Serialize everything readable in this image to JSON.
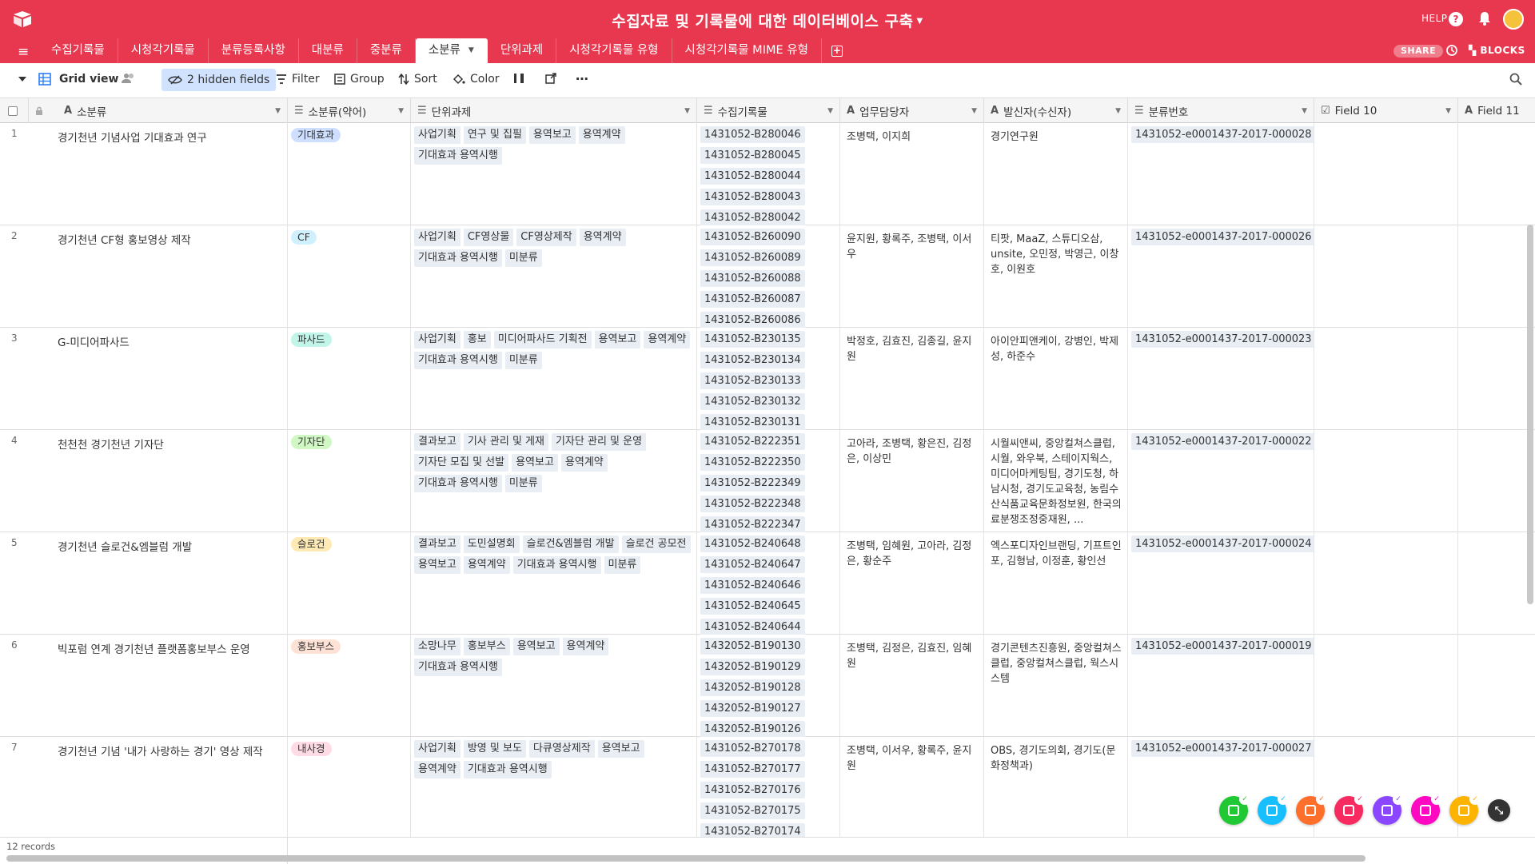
{
  "app": {
    "base_title": "수집자료 및 기록물에 대한 데이터베이스 구축",
    "help_label": "HELP",
    "share_label": "SHARE",
    "blocks_label": "BLOCKS",
    "brand_color": "#e8384f"
  },
  "tabs": [
    {
      "label": "수집기록물"
    },
    {
      "label": "시청각기록물"
    },
    {
      "label": "분류등록사항"
    },
    {
      "label": "대분류"
    },
    {
      "label": "중분류"
    },
    {
      "label": "소분류",
      "active": true
    },
    {
      "label": "단위과제"
    },
    {
      "label": "시청각기록물 유형"
    },
    {
      "label": "시청각기록물 MIME 유형"
    }
  ],
  "toolbar": {
    "view_name": "Grid view",
    "hidden_fields": "2 hidden fields",
    "filter": "Filter",
    "group": "Group",
    "sort": "Sort",
    "color": "Color"
  },
  "columns": [
    {
      "name": "소분류",
      "icon": "A"
    },
    {
      "name": "소분류(약어)",
      "icon": "☰"
    },
    {
      "name": "단위과제",
      "icon": "☰"
    },
    {
      "name": "수집기록물",
      "icon": "☰"
    },
    {
      "name": "업무담당자",
      "icon": "A"
    },
    {
      "name": "발신자(수신자)",
      "icon": "A"
    },
    {
      "name": "분류번호",
      "icon": "☰"
    },
    {
      "name": "Field 10",
      "icon": "☑"
    },
    {
      "name": "Field 11",
      "icon": "A"
    }
  ],
  "rows": [
    {
      "num": "1",
      "name": "경기천년 기념사업 기대효과 연구",
      "abbr": "기대효과",
      "abbr_color": "#cfdfff",
      "tasks": [
        "사업기획",
        "연구 및 집필",
        "용역보고",
        "용역계약",
        "기대효과 용역시행"
      ],
      "records": [
        "1431052-B280046",
        "1431052-B280045",
        "1431052-B280044",
        "1431052-B280043",
        "1431052-B280042"
      ],
      "manager": "조병택, 이지희",
      "sender": "경기연구원",
      "classno": "1431052-e0001437-2017-000028"
    },
    {
      "num": "2",
      "name": "경기천년 CF형 홍보영상 제작",
      "abbr": "CF",
      "abbr_color": "#d0f0fd",
      "tasks": [
        "사업기획",
        "CF영상물",
        "CF영상제작",
        "용역계약",
        "기대효과 용역시행",
        "미분류"
      ],
      "records": [
        "1431052-B260090",
        "1431052-B260089",
        "1431052-B260088",
        "1431052-B260087",
        "1431052-B260086"
      ],
      "manager": "윤지원, 황록주, 조병택, 이서우",
      "sender": "티팟, MaaZ, 스튜디오삼, unsite, 오민정, 박영근, 이창호, 이원호",
      "classno": "1431052-e0001437-2017-000026"
    },
    {
      "num": "3",
      "name": "G-미디어파사드",
      "abbr": "파사드",
      "abbr_color": "#c2f5e9",
      "tasks": [
        "사업기획",
        "홍보",
        "미디어파사드 기획전",
        "용역보고",
        "용역계약",
        "기대효과 용역시행",
        "미분류"
      ],
      "records": [
        "1431052-B230135",
        "1431052-B230134",
        "1431052-B230133",
        "1431052-B230132",
        "1431052-B230131"
      ],
      "manager": "박정호, 김효진, 김종길, 윤지원",
      "sender": "아이안피앤케이, 강병인, 박제성, 하준수",
      "classno": "1431052-e0001437-2017-000023"
    },
    {
      "num": "4",
      "name": "천천천 경기천년 기자단",
      "abbr": "기자단",
      "abbr_color": "#d1f7c4",
      "tasks": [
        "결과보고",
        "기사 관리 및 게재",
        "기자단 관리 및 운영",
        "기자단 모집 및 선발",
        "용역보고",
        "용역계약",
        "기대효과 용역시행",
        "미분류"
      ],
      "records": [
        "1431052-B222351",
        "1431052-B222350",
        "1431052-B222349",
        "1431052-B222348",
        "1431052-B222347"
      ],
      "manager": "고아라, 조병택, 황은진, 김정은, 이상민",
      "sender": "시월씨앤씨, 중앙컬쳐스클럽, 시월, 와우북, 스테이지웍스, 미디어마케팅팀, 경기도청, 하남시청, 경기도교육청, 농림수산식품교육문화정보원, 한국의료분쟁조정중재원, ...",
      "classno": "1431052-e0001437-2017-000022"
    },
    {
      "num": "5",
      "name": "경기천년 슬로건&엠블럼 개발",
      "abbr": "슬로건",
      "abbr_color": "#ffeab6",
      "tasks": [
        "결과보고",
        "도민설명회",
        "슬로건&엠블럼 개발",
        "슬로건 공모전",
        "용역보고",
        "용역계약",
        "기대효과 용역시행",
        "미분류"
      ],
      "records": [
        "1431052-B240648",
        "1431052-B240647",
        "1431052-B240646",
        "1431052-B240645",
        "1431052-B240644"
      ],
      "manager": "조병택, 임혜원, 고아라, 김정은, 황순주",
      "sender": "엑스포디자인브랜딩, 기프트인포, 김형남, 이정훈, 황인선",
      "classno": "1431052-e0001437-2017-000024"
    },
    {
      "num": "6",
      "name": "빅포럼 연계 경기천년 플랫폼홍보부스 운영",
      "abbr": "홍보부스",
      "abbr_color": "#fee2d5",
      "tasks": [
        "소망나무",
        "홍보부스",
        "용역보고",
        "용역계약",
        "기대효과 용역시행"
      ],
      "records": [
        "1432052-B190130",
        "1432052-B190129",
        "1432052-B190128",
        "1432052-B190127",
        "1432052-B190126"
      ],
      "manager": "조병택, 김정은, 김효진, 임혜원",
      "sender": "경기콘텐츠진흥원, 중앙컬쳐스클럽, 중앙컬쳐스클럽, 웍스시스템",
      "classno": "1431052-e0001437-2017-000019"
    },
    {
      "num": "7",
      "name": "경기천년 기념 '내가 사랑하는 경기' 영상 제작",
      "abbr": "내사경",
      "abbr_color": "#ffdce5",
      "tasks": [
        "사업기획",
        "방영 및 보도",
        "다큐영상제작",
        "용역보고",
        "용역계약",
        "기대효과 용역시행"
      ],
      "records": [
        "1431052-B270178",
        "1431052-B270177",
        "1431052-B270176",
        "1431052-B270175",
        "1431052-B270174"
      ],
      "manager": "조병택, 이서우, 황록주, 윤지원",
      "sender": "OBS, 경기도의회, 경기도(문화정책과)",
      "classno": "1431052-e0001437-2017-000027"
    }
  ],
  "footer": {
    "records_count": "12 records"
  },
  "dock": [
    {
      "name": "dock-app-green",
      "color": "#20c933"
    },
    {
      "name": "dock-app-blue",
      "color": "#18bfff"
    },
    {
      "name": "dock-app-orange",
      "color": "#ff6f2c"
    },
    {
      "name": "dock-app-red",
      "color": "#f82b60"
    },
    {
      "name": "dock-app-purple",
      "color": "#8b46ff"
    },
    {
      "name": "dock-app-pink",
      "color": "#ff08c2"
    },
    {
      "name": "dock-app-yellow",
      "color": "#fcb400"
    }
  ]
}
